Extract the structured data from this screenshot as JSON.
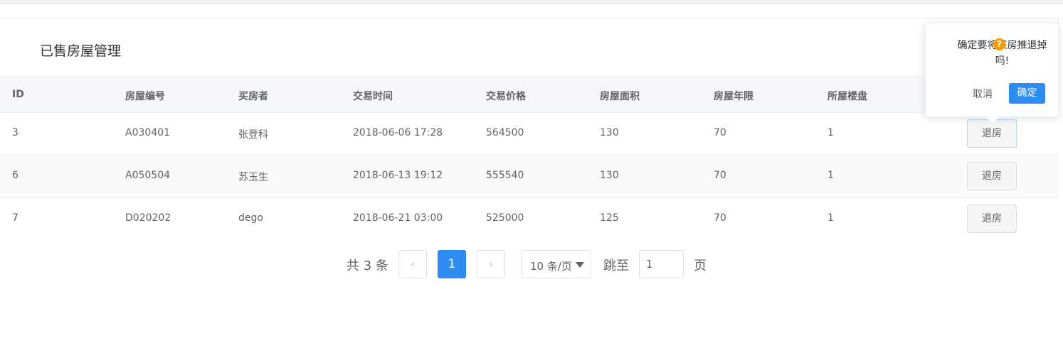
{
  "card": {
    "title": "已售房屋管理"
  },
  "table": {
    "headers": [
      "ID",
      "房屋编号",
      "买房者",
      "交易时间",
      "交易价格",
      "房屋面积",
      "房屋年限",
      "所屋楼盘"
    ],
    "rows": [
      {
        "id": "3",
        "code": "A030401",
        "buyer": "张登科",
        "time": "2018-06-06 17:28",
        "price": "564500",
        "area": "130",
        "years": "70",
        "building": "1",
        "action": "退房"
      },
      {
        "id": "6",
        "code": "A050504",
        "buyer": "苏玉生",
        "time": "2018-06-13 19:12",
        "price": "555540",
        "area": "130",
        "years": "70",
        "building": "1",
        "action": "退房"
      },
      {
        "id": "7",
        "code": "D020202",
        "buyer": "dego",
        "time": "2018-06-21 03:00",
        "price": "525000",
        "area": "125",
        "years": "70",
        "building": "1",
        "action": "退房"
      }
    ]
  },
  "pagination": {
    "total_text": "共 3 条",
    "prev_icon": "‹",
    "current_page": "1",
    "next_icon": "›",
    "page_size": "10 条/页",
    "jump_label": "跳至",
    "jump_value": "1",
    "page_suffix": "页"
  },
  "popconfirm": {
    "message": "确定要将该房推退掉吗!",
    "warn_symbol": "?",
    "cancel_label": "取消",
    "confirm_label": "确定",
    "warn_color": "#ff9900",
    "primary_color": "#2d8cf0"
  }
}
